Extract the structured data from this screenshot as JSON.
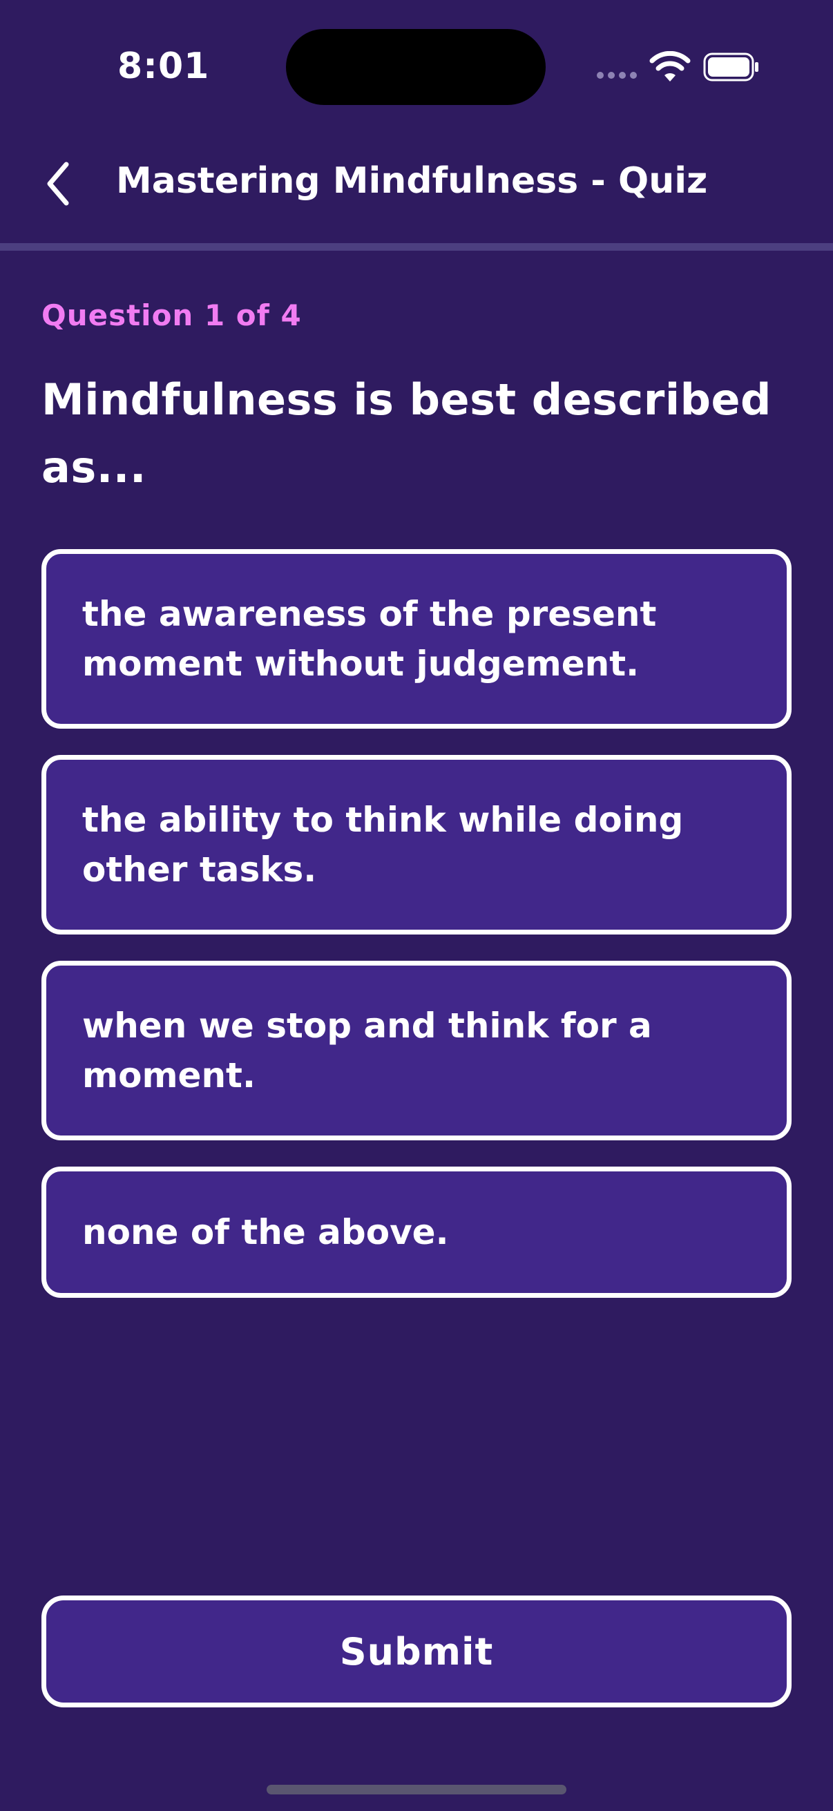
{
  "status_bar": {
    "time": "8:01",
    "icons": [
      "signal-dots-icon",
      "wifi-icon",
      "battery-icon"
    ]
  },
  "header": {
    "back_icon": "chevron-left-icon",
    "title": "Mastering Mindfulness - Quiz"
  },
  "quiz": {
    "counter": "Question 1 of 4",
    "question": "Mindfulness is best described as...",
    "options": [
      {
        "label": "the awareness of the present moment without judgement."
      },
      {
        "label": "the ability to think while doing other tasks."
      },
      {
        "label": "when we stop and think for a moment."
      },
      {
        "label": "none of the above."
      }
    ]
  },
  "actions": {
    "submit_label": "Submit"
  },
  "colors": {
    "background": "#2F1B60",
    "option_fill": "#41278A",
    "accent": "#F17CF2",
    "divider": "#4C3F80"
  }
}
